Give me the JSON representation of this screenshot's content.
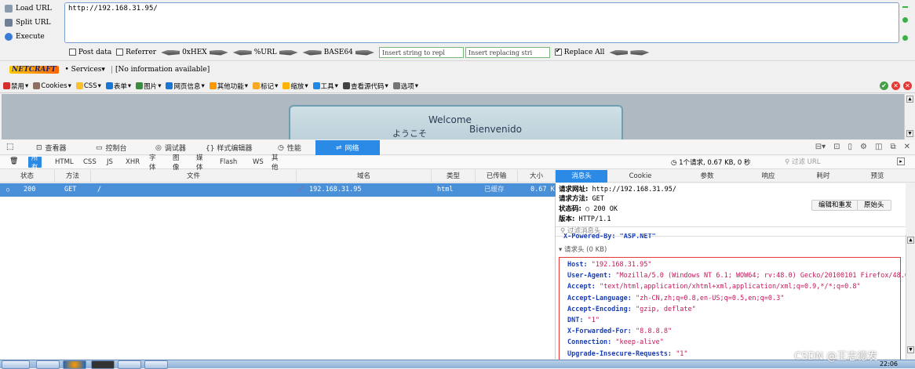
{
  "hackbar": {
    "load_url": "Load URL",
    "split_url": "Split URL",
    "execute": "Execute",
    "url_value": "http://192.168.31.95/",
    "post_data": "Post data",
    "referrer": "Referrer",
    "hex": "0xHEX",
    "url_enc": "%URL",
    "base64": "BASE64",
    "insert_string": "Insert string to repl",
    "insert_replacing": "Insert replacing stri",
    "replace_all": "Replace All"
  },
  "netcraft": {
    "logo": "NETCRAFT",
    "services": "Services",
    "info": "[No information available]"
  },
  "webdev": {
    "items": [
      "禁用",
      "Cookies",
      "CSS",
      "表单",
      "图片",
      "网页信息",
      "其他功能",
      "标记",
      "缩放",
      "工具",
      "查看源代码",
      "选项"
    ]
  },
  "page": {
    "welcome": "Welcome",
    "jp": "ようこそ",
    "es": "Bienvenido"
  },
  "devtools": {
    "tabs": [
      "查看器",
      "控制台",
      "调试器",
      "{} 样式编辑器",
      "性能",
      "网络"
    ],
    "filters": [
      "所有",
      "HTML",
      "CSS",
      "JS",
      "XHR",
      "字体",
      "图像",
      "媒体",
      "Flash",
      "WS",
      "其他"
    ],
    "summary": "1个请求, 0.67 KB, 0 秒",
    "filter_url": "过滤 URL",
    "columns": [
      "状态",
      "方法",
      "文件",
      "域名",
      "类型",
      "已传输",
      "大小"
    ],
    "row": {
      "status": "200",
      "method": "GET",
      "file": "/",
      "domain": "192.168.31.95",
      "type": "html",
      "transferred": "已缓存",
      "size": "0.67 K"
    }
  },
  "details": {
    "tabs": [
      "消息头",
      "Cookie",
      "参数",
      "响应",
      "耗时",
      "预览"
    ],
    "url_label": "请求网址:",
    "url": "http://192.168.31.95/",
    "method_label": "请求方法:",
    "method": "GET",
    "status_label": "状态码:",
    "status": "200 OK",
    "version_label": "版本:",
    "version": "HTTP/1.1",
    "edit_resend": "编辑和重发",
    "raw_headers": "原始头",
    "filter_headers": "过滤消息头",
    "cut_line": "X-Powered-By: \"ASP.NET\"",
    "req_headers_title": "请求头 (0 KB)",
    "headers": [
      {
        "k": "Host:",
        "v": "\"192.168.31.95\""
      },
      {
        "k": "User-Agent:",
        "v": "\"Mozilla/5.0 (Windows NT 6.1; WOW64; rv:48.0) Gecko/20100101 Firefox/48.0\""
      },
      {
        "k": "Accept:",
        "v": "\"text/html,application/xhtml+xml,application/xml;q=0.9,*/*;q=0.8\""
      },
      {
        "k": "Accept-Language:",
        "v": "\"zh-CN,zh;q=0.8,en-US;q=0.5,en;q=0.3\""
      },
      {
        "k": "Accept-Encoding:",
        "v": "\"gzip, deflate\""
      },
      {
        "k": "DNT:",
        "v": "\"1\""
      },
      {
        "k": "X-Forwarded-For:",
        "v": "\"8.8.8.8\""
      },
      {
        "k": "Connection:",
        "v": "\"keep-alive\""
      },
      {
        "k": "Upgrade-Insecure-Requests:",
        "v": "\"1\""
      }
    ]
  },
  "watermark": "CSDN @王志德发",
  "clock": "22:06"
}
